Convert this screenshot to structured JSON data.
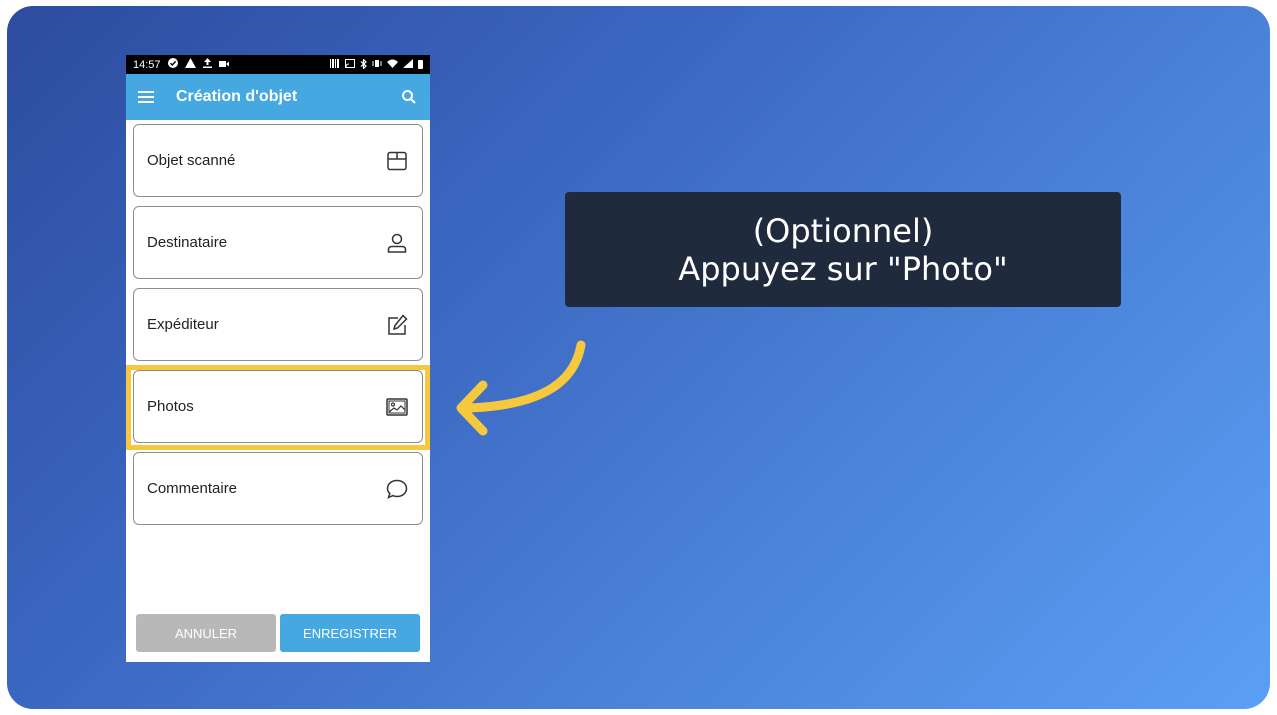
{
  "statusbar": {
    "time": "14:57"
  },
  "appbar": {
    "title": "Création d'objet"
  },
  "cards": [
    {
      "label": "Objet scanné",
      "icon": "box-icon"
    },
    {
      "label": "Destinataire",
      "icon": "person-icon"
    },
    {
      "label": "Expéditeur",
      "icon": "edit-icon"
    },
    {
      "label": "Photos",
      "icon": "image-icon"
    },
    {
      "label": "Commentaire",
      "icon": "comment-icon"
    }
  ],
  "buttons": {
    "cancel": "ANNULER",
    "save": "ENREGISTRER"
  },
  "callout": {
    "line1": "(Optionnel)",
    "line2": "Appuyez sur \"Photo\""
  },
  "colors": {
    "accent": "#46a8e0",
    "highlight": "#f6c83e",
    "callout_bg": "#1f2a3c"
  }
}
